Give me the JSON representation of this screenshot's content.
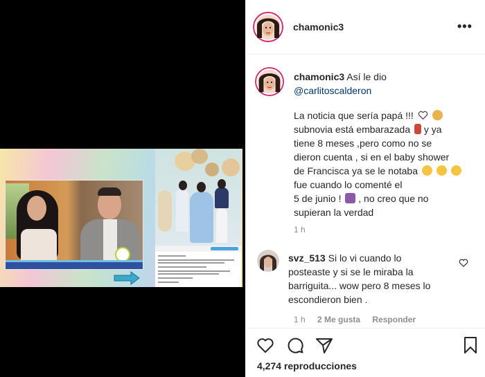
{
  "header": {
    "username": "chamonic3",
    "more_label": "•••"
  },
  "caption": {
    "username": "chamonic3",
    "intro": "Así le dio",
    "mention": "@carlitoscalderon",
    "lines": [
      "La noticia que sería papá !!!",
      "subnovia está embarazada",
      "tiene 8 meses ,pero como no se",
      "dieron cuenta , si en el baby shower",
      "de Francisca ya se le notaba",
      "fue cuando lo comenté el",
      "5 de junio !",
      "supieran la verdad"
    ],
    "line2_tail": "y ya",
    "line7_tail": ", no creo que no",
    "time": "1 h"
  },
  "comment": {
    "username": "svz_513",
    "lines": [
      "Si lo vi cuando lo",
      "posteaste y si se le miraba la",
      "barriguita... wow pero 8 meses lo",
      "escondieron bien ."
    ],
    "time": "1 h",
    "likes": "2 Me gusta",
    "reply": "Responder"
  },
  "actions": {
    "views": "4,274 reproducciones"
  },
  "icons": [
    "heart-icon",
    "comment-icon",
    "share-icon",
    "bookmark-icon",
    "more-icon"
  ],
  "colors": {
    "mention": "#00376b",
    "meta": "#8e8e8e",
    "text": "#262626"
  }
}
